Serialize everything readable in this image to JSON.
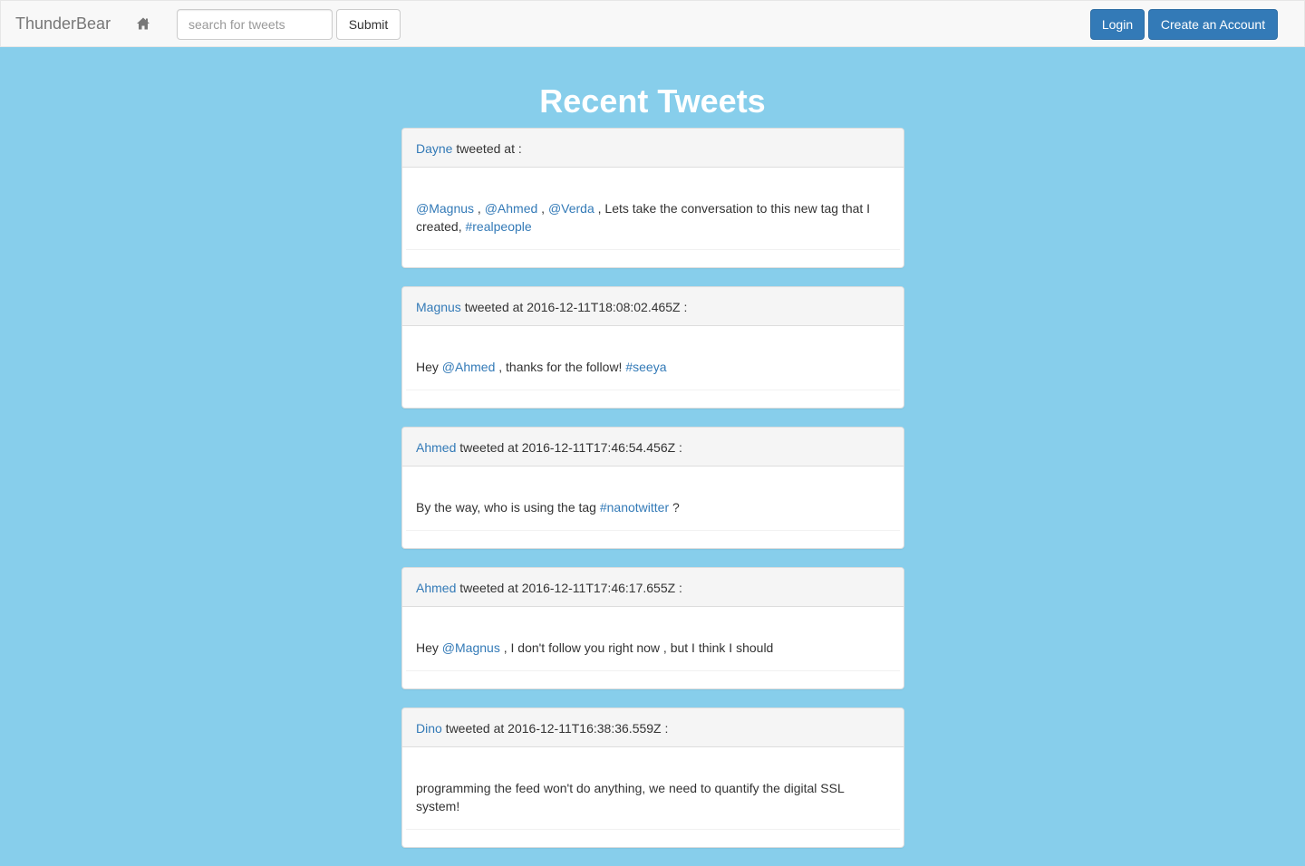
{
  "navbar": {
    "brand": "ThunderBear",
    "home_icon": "home-icon",
    "search_placeholder": "search for tweets",
    "submit_label": "Submit",
    "login_label": "Login",
    "create_account_label": "Create an Account"
  },
  "page_title": "Recent Tweets",
  "colors": {
    "background": "#87ceeb",
    "link": "#337ab7",
    "primary_button": "#337ab7"
  },
  "tweets": [
    {
      "user": "Dayne",
      "header_suffix": " tweeted at :",
      "body": [
        {
          "t": "@Magnus",
          "link": true
        },
        {
          "t": " , ",
          "link": false
        },
        {
          "t": "@Ahmed",
          "link": true
        },
        {
          "t": " , ",
          "link": false
        },
        {
          "t": "@Verda",
          "link": true
        },
        {
          "t": " , Lets take the conversation to this new tag that I created, ",
          "link": false
        },
        {
          "t": "#realpeople",
          "link": true
        }
      ]
    },
    {
      "user": "Magnus",
      "header_suffix": " tweeted at 2016-12-11T18:08:02.465Z :",
      "body": [
        {
          "t": "Hey ",
          "link": false
        },
        {
          "t": "@Ahmed",
          "link": true
        },
        {
          "t": " , thanks for the follow! ",
          "link": false
        },
        {
          "t": "#seeya",
          "link": true
        }
      ]
    },
    {
      "user": "Ahmed",
      "header_suffix": " tweeted at 2016-12-11T17:46:54.456Z :",
      "body": [
        {
          "t": "By the way, who is using the tag ",
          "link": false
        },
        {
          "t": "#nanotwitter",
          "link": true
        },
        {
          "t": " ?",
          "link": false
        }
      ]
    },
    {
      "user": "Ahmed",
      "header_suffix": " tweeted at 2016-12-11T17:46:17.655Z :",
      "body": [
        {
          "t": "Hey ",
          "link": false
        },
        {
          "t": "@Magnus",
          "link": true
        },
        {
          "t": " , I don't follow you right now , but I think I should",
          "link": false
        }
      ]
    },
    {
      "user": "Dino",
      "header_suffix": " tweeted at 2016-12-11T16:38:36.559Z :",
      "body": [
        {
          "t": "programming the feed won't do anything, we need to quantify the digital SSL system!",
          "link": false
        }
      ]
    }
  ]
}
